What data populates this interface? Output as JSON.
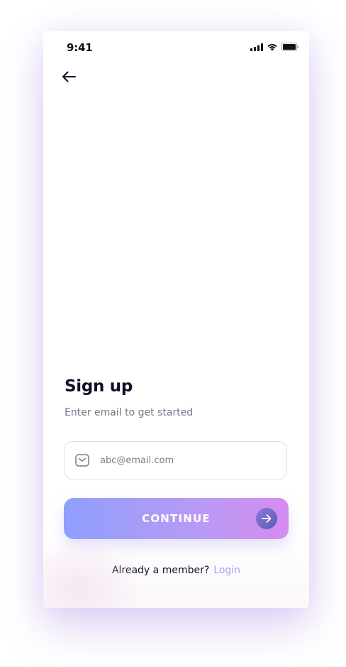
{
  "status_bar": {
    "time": "9:41",
    "icons": [
      "cellular-signal-icon",
      "wifi-icon",
      "battery-icon"
    ]
  },
  "nav": {
    "back_icon": "arrow-left-icon"
  },
  "signup": {
    "title": "Sign up",
    "subtitle": "Enter email to get started",
    "email_field": {
      "icon": "mail-icon",
      "placeholder": "abc@email.com",
      "value": ""
    },
    "continue_button": {
      "label": "CONTINUE",
      "icon": "arrow-right-icon"
    },
    "footer": {
      "text": "Already a member?",
      "link": "Login"
    }
  },
  "colors": {
    "title": "#120d26",
    "subtitle": "#747688",
    "button_gradient_start": "#8ea0fc",
    "button_gradient_end": "#d58cef",
    "link": "#9aa5f0"
  }
}
